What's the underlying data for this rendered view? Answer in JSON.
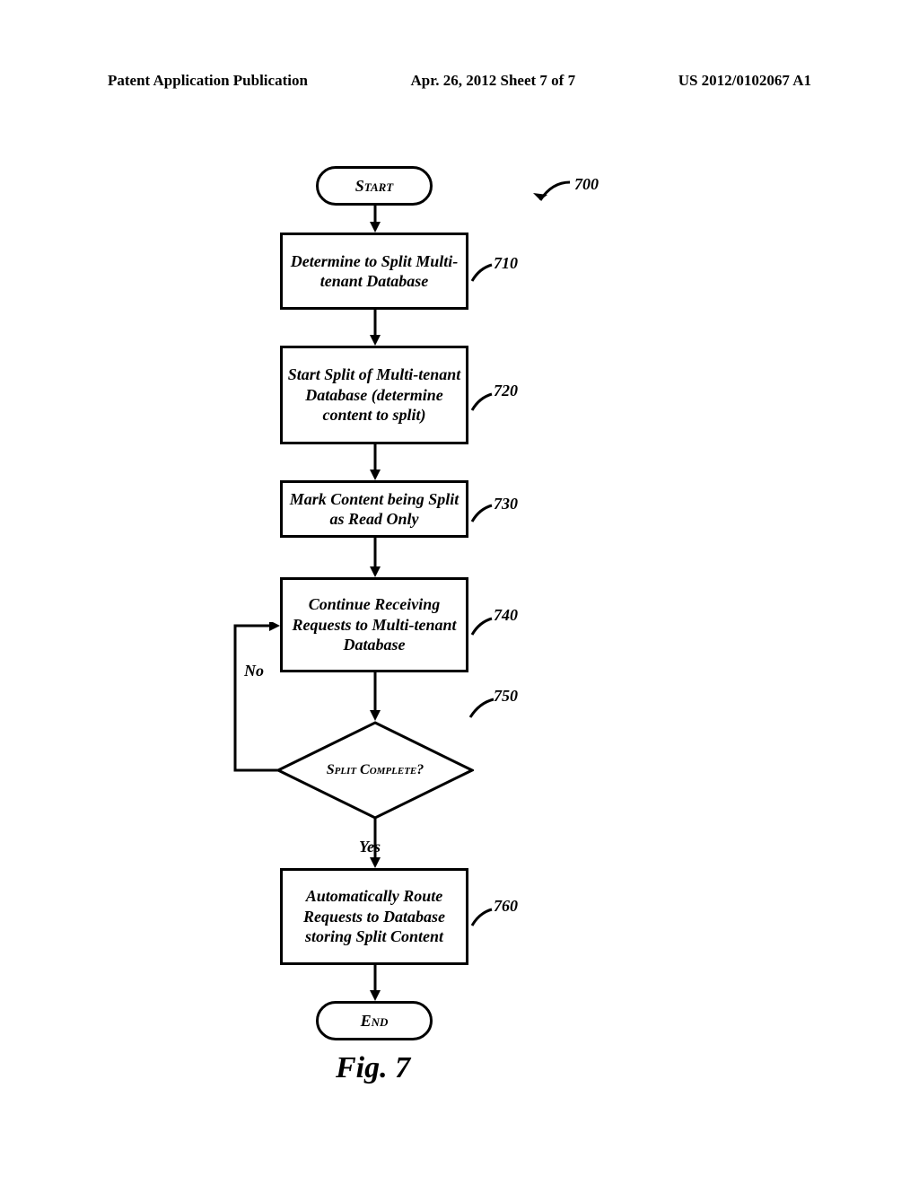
{
  "header": {
    "left": "Patent Application Publication",
    "center": "Apr. 26, 2012  Sheet 7 of 7",
    "right": "US 2012/0102067 A1"
  },
  "flowchart": {
    "start": "Start",
    "end": "End",
    "reference_main": "700",
    "steps": [
      {
        "ref": "710",
        "text": "Determine to Split Multi-tenant Database"
      },
      {
        "ref": "720",
        "text": "Start Split of Multi-tenant Database (determine content to split)"
      },
      {
        "ref": "730",
        "text": "Mark Content being Split as Read Only"
      },
      {
        "ref": "740",
        "text": "Continue Receiving Requests to Multi-tenant Database"
      },
      {
        "ref": "760",
        "text": "Automatically Route Requests to Database storing Split Content"
      }
    ],
    "decision": {
      "ref": "750",
      "text": "Split Complete?"
    },
    "edge_no": "No",
    "edge_yes": "Yes"
  },
  "figure_caption": "Fig. 7"
}
